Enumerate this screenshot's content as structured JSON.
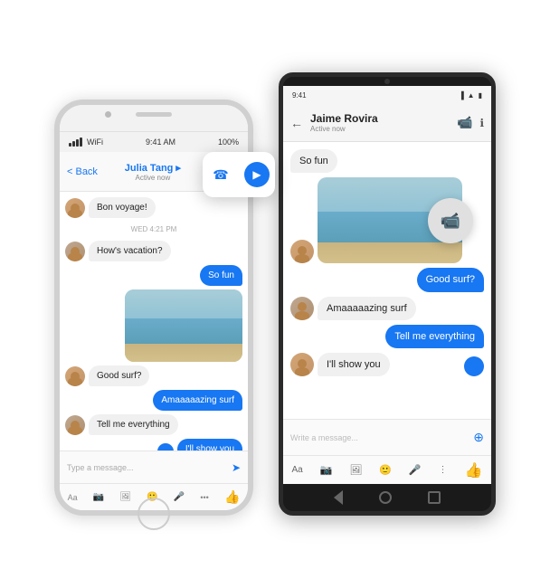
{
  "iphone": {
    "status": {
      "signal": "●●●●",
      "wifi": "WiFi",
      "time": "9:41 AM",
      "battery": "100%"
    },
    "header": {
      "back_label": "< Back",
      "contact_name": "Julia Tang ▸",
      "active_status": "Active now",
      "phone_icon": "phone",
      "video_icon": "video-camera"
    },
    "messages": [
      {
        "type": "received",
        "text": "Bon voyage!"
      },
      {
        "type": "date",
        "text": "WED 4:21 PM"
      },
      {
        "type": "received",
        "text": "How's vacation?"
      },
      {
        "type": "sent",
        "text": "So fun"
      },
      {
        "type": "image",
        "side": "sent"
      },
      {
        "type": "received",
        "text": "Good surf?"
      },
      {
        "type": "sent",
        "text": "Amaaaaazing surf"
      },
      {
        "type": "received",
        "text": "Tell me everything"
      },
      {
        "type": "sent",
        "text": "I'll show you"
      }
    ],
    "input_placeholder": "Type a message...",
    "toolbar_icons": [
      "Aa",
      "camera",
      "photo",
      "emoji",
      "mic",
      "more",
      "like"
    ]
  },
  "android": {
    "status": {
      "time": "9:41",
      "icons": "signal wifi battery"
    },
    "header": {
      "back_icon": "arrow-left",
      "contact_name": "Jaime Rovira",
      "active_status": "Active now",
      "video_icon": "video-camera",
      "info_icon": "info"
    },
    "messages": [
      {
        "type": "received",
        "text": "So fun"
      },
      {
        "type": "image",
        "side": "received"
      },
      {
        "type": "sent",
        "text": "Good surf?"
      },
      {
        "type": "received",
        "text": "Amaaaaazing surf"
      },
      {
        "type": "sent",
        "text": "Tell me everything"
      },
      {
        "type": "received",
        "text": "I'll show you"
      }
    ],
    "input_placeholder": "Write a message...",
    "toolbar_icons": [
      "Aa",
      "camera",
      "photo",
      "emoji",
      "mic",
      "more"
    ],
    "like_icon": "thumbs-up"
  }
}
